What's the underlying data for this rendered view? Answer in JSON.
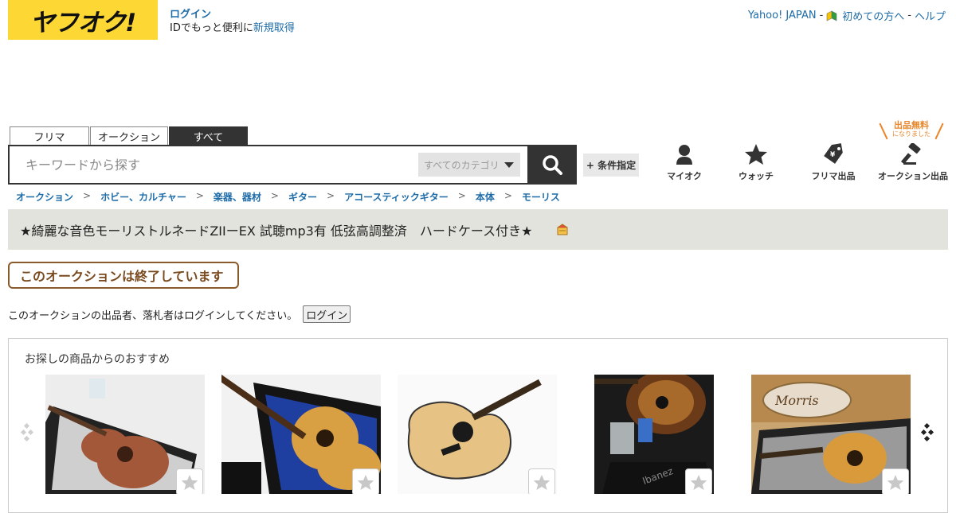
{
  "header": {
    "logo_text": "ヤフオク!",
    "login_label": "ログイン",
    "login_prompt": "IDでもっと便利に",
    "register_label": "新規取得",
    "yahoo_japan_label": "Yahoo! JAPAN",
    "separator": "-",
    "beginner_label": "初めての方へ",
    "help_label": "ヘルプ"
  },
  "search": {
    "tabs": [
      "フリマ",
      "オークション",
      "すべて"
    ],
    "active_tab": "すべて",
    "placeholder": "キーワードから探す",
    "category_label": "すべてのカテゴリ",
    "condition_label": "+ 条件指定"
  },
  "nav": {
    "items": [
      "マイオク",
      "ウォッチ",
      "フリマ出品",
      "オークション出品"
    ],
    "promo_main": "出品無料",
    "promo_sub": "になりました"
  },
  "breadcrumbs": [
    "オークション",
    "ホビー、カルチャー",
    "楽器、器材",
    "ギター",
    "アコースティックギター",
    "本体",
    "モーリス"
  ],
  "breadcrumb_separator": ">",
  "item": {
    "title": "★綺麗な音色モーリストルネードZIIーEX 試聴mp3有 低弦高調整済　ハードケース付き★",
    "status_label": "このオークションは終了しています",
    "login_note": "このオークションの出品者、落札者はログインしてください。",
    "login_button": "ログイン"
  },
  "recommend": {
    "title": "お探しの商品からのおすすめ",
    "items": [
      {
        "name": "guitar-in-case-1"
      },
      {
        "name": "guitar-in-blue-case"
      },
      {
        "name": "acoustic-guitar-white-bg"
      },
      {
        "name": "sunburst-guitar-with-accessories"
      },
      {
        "name": "morris-guitar-in-case"
      }
    ]
  },
  "colors": {
    "brand_yellow": "#fdd835",
    "link_blue": "#1e6ca8",
    "dark": "#333333",
    "status_brown": "#7a4a1f",
    "promo_orange": "#e9862a"
  }
}
